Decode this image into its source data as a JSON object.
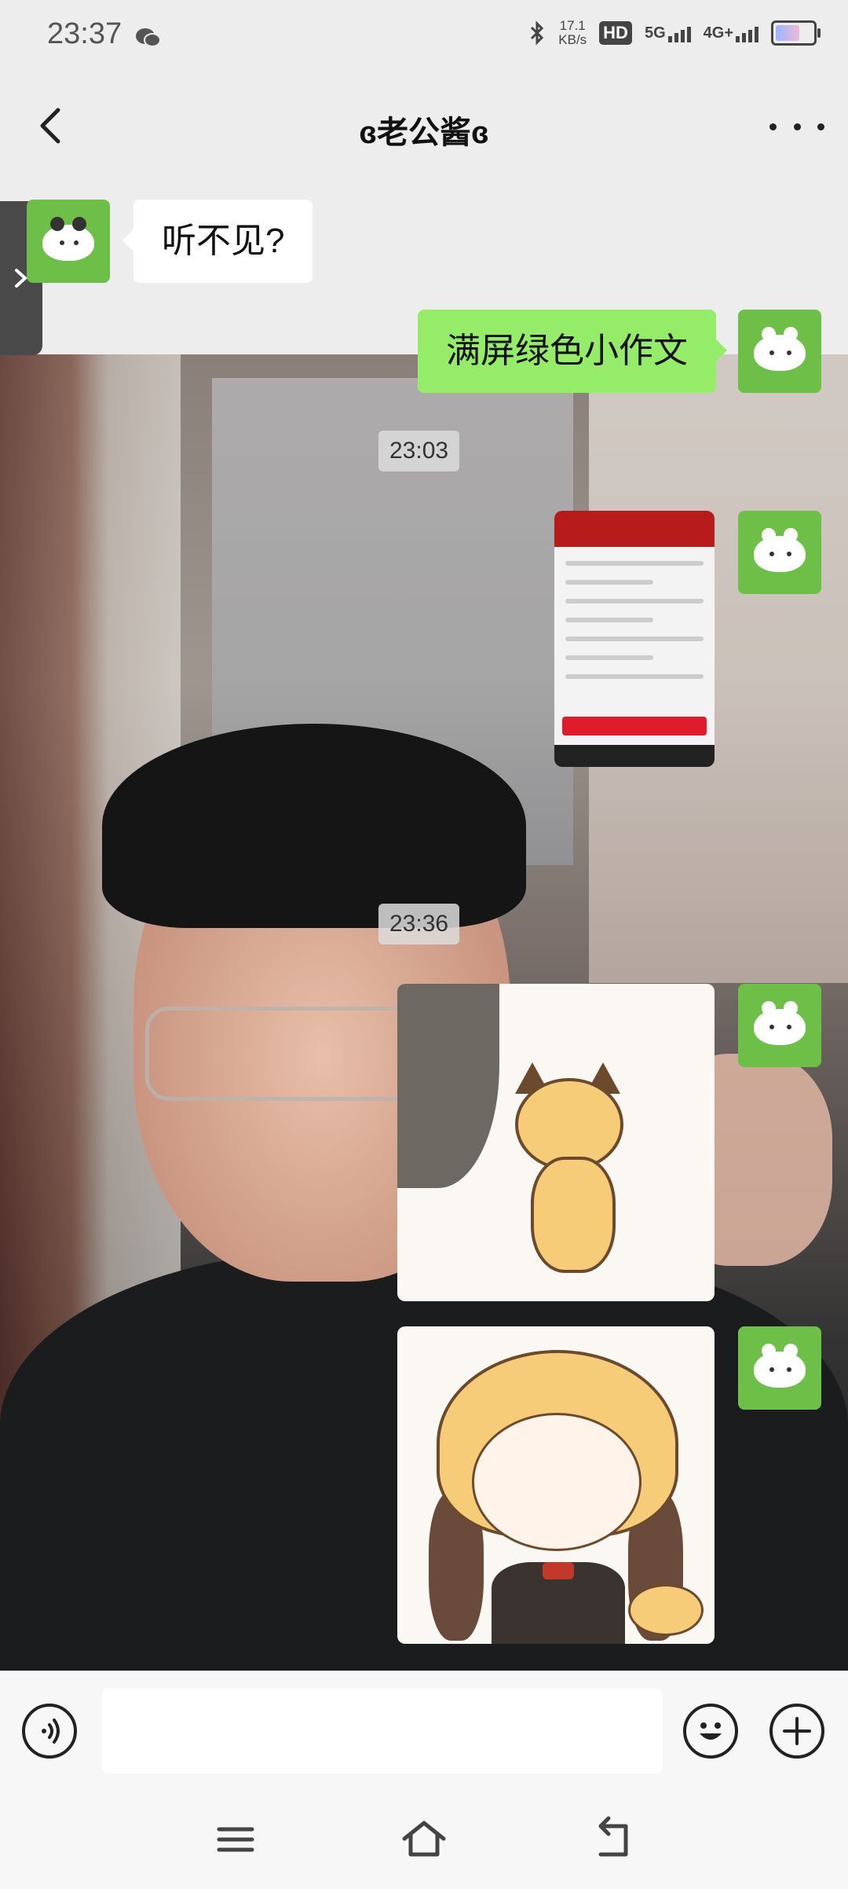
{
  "status_bar": {
    "time": "23:37",
    "net_speed_top": "17.1",
    "net_speed_bottom": "KB/s",
    "hd_label": "HD",
    "sim1_label": "5G",
    "sim2_label": "4G+",
    "icons": [
      "wechat-icon",
      "bluetooth-icon",
      "signal-icon",
      "battery-icon"
    ]
  },
  "header": {
    "title": "ɞ老公酱ɞ",
    "icons": [
      "back-arrow-icon",
      "more-icon"
    ]
  },
  "messages": [
    {
      "side": "left",
      "type": "text",
      "text": "听不见?",
      "avatar": "panda-avatar"
    },
    {
      "side": "right",
      "type": "text",
      "text": "满屏绿色小作文",
      "avatar": "hamster-avatar"
    },
    {
      "type": "time",
      "text": "23:03"
    },
    {
      "side": "right",
      "type": "image",
      "content": "app-screenshot",
      "avatar": "hamster-avatar"
    },
    {
      "type": "time",
      "text": "23:36"
    },
    {
      "side": "right",
      "type": "image",
      "content": "cat-sticker",
      "avatar": "hamster-avatar"
    },
    {
      "side": "right",
      "type": "image",
      "content": "girl-cat-sticker",
      "avatar": "hamster-avatar"
    }
  ],
  "input_bar": {
    "value": "",
    "icons": [
      "voice-icon",
      "emoji-icon",
      "plus-icon"
    ]
  },
  "system_nav": {
    "icons": [
      "menu-icon",
      "home-icon",
      "back-icon"
    ]
  },
  "colors": {
    "chat_background": "#ededed",
    "outgoing_bubble": "#95ec69",
    "incoming_bubble": "#ffffff",
    "avatar_green": "#6dbf47"
  }
}
